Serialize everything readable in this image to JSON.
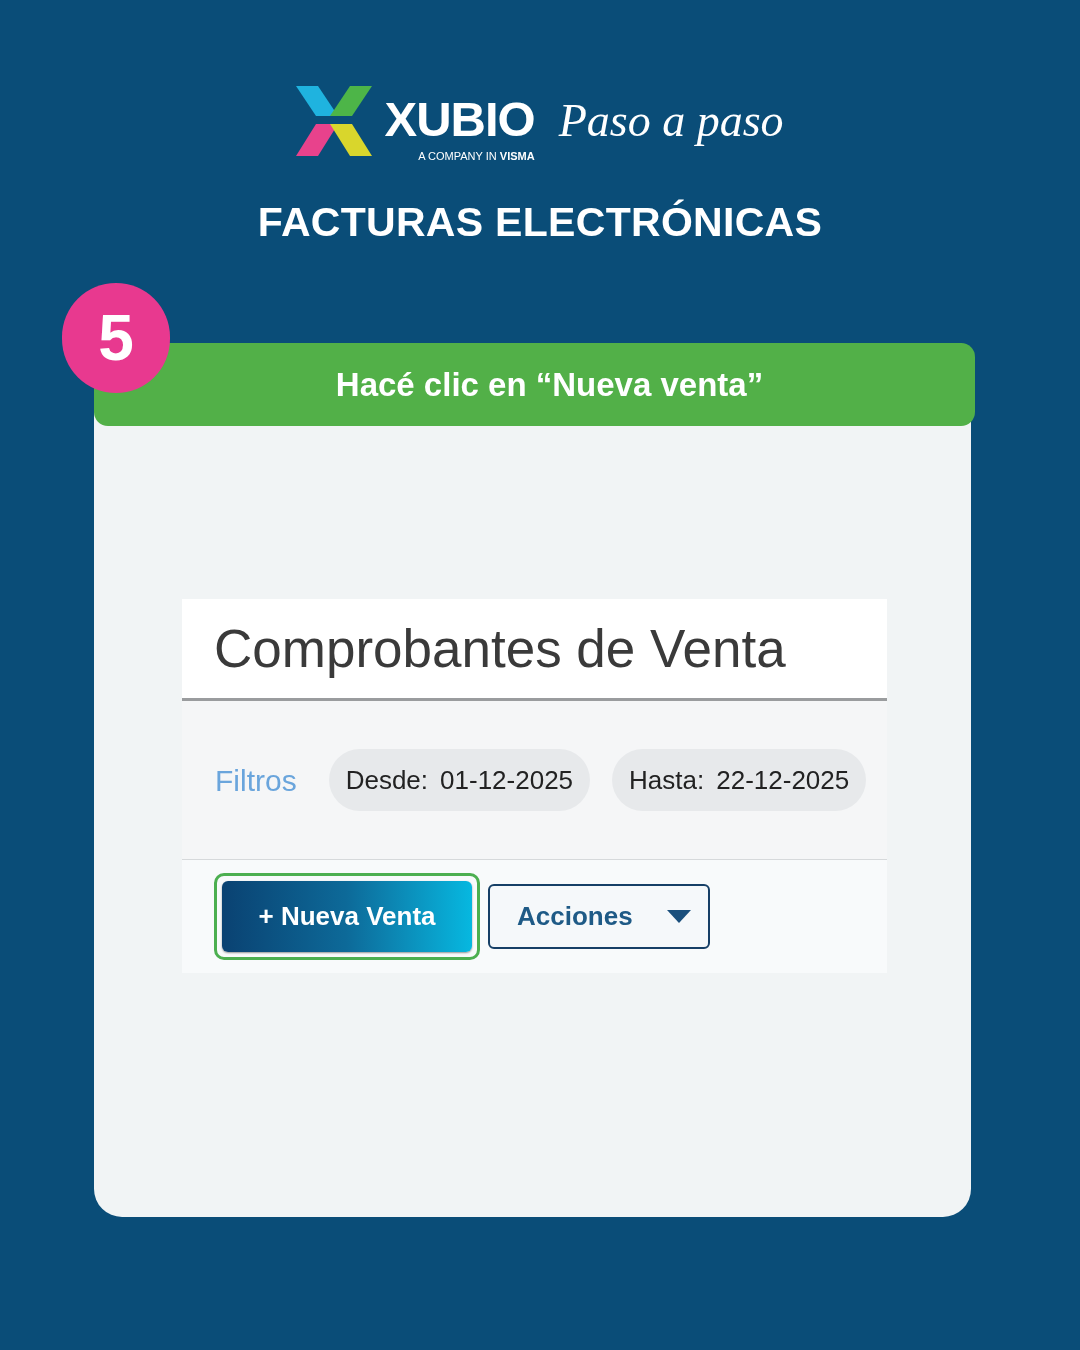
{
  "brand": {
    "name": "XUBIO",
    "tagline": "A COMPANY IN **VISMA**",
    "script": "Paso a paso"
  },
  "title": "FACTURAS ELECTRÓNICAS",
  "step": {
    "number": "5",
    "instruction": "Hacé clic en “Nueva venta”"
  },
  "screen": {
    "title": "Comprobantes de Venta",
    "filters_label": "Filtros",
    "filters": [
      {
        "label": "Desde:",
        "value": "01-12-2025"
      },
      {
        "label": "Hasta:",
        "value": "22-12-2025"
      }
    ],
    "buttons": [
      {
        "kind": "primary",
        "label": "+ Nueva Venta",
        "highlighted": true
      },
      {
        "kind": "dropdown",
        "label": "Acciones",
        "highlighted": false
      }
    ]
  }
}
